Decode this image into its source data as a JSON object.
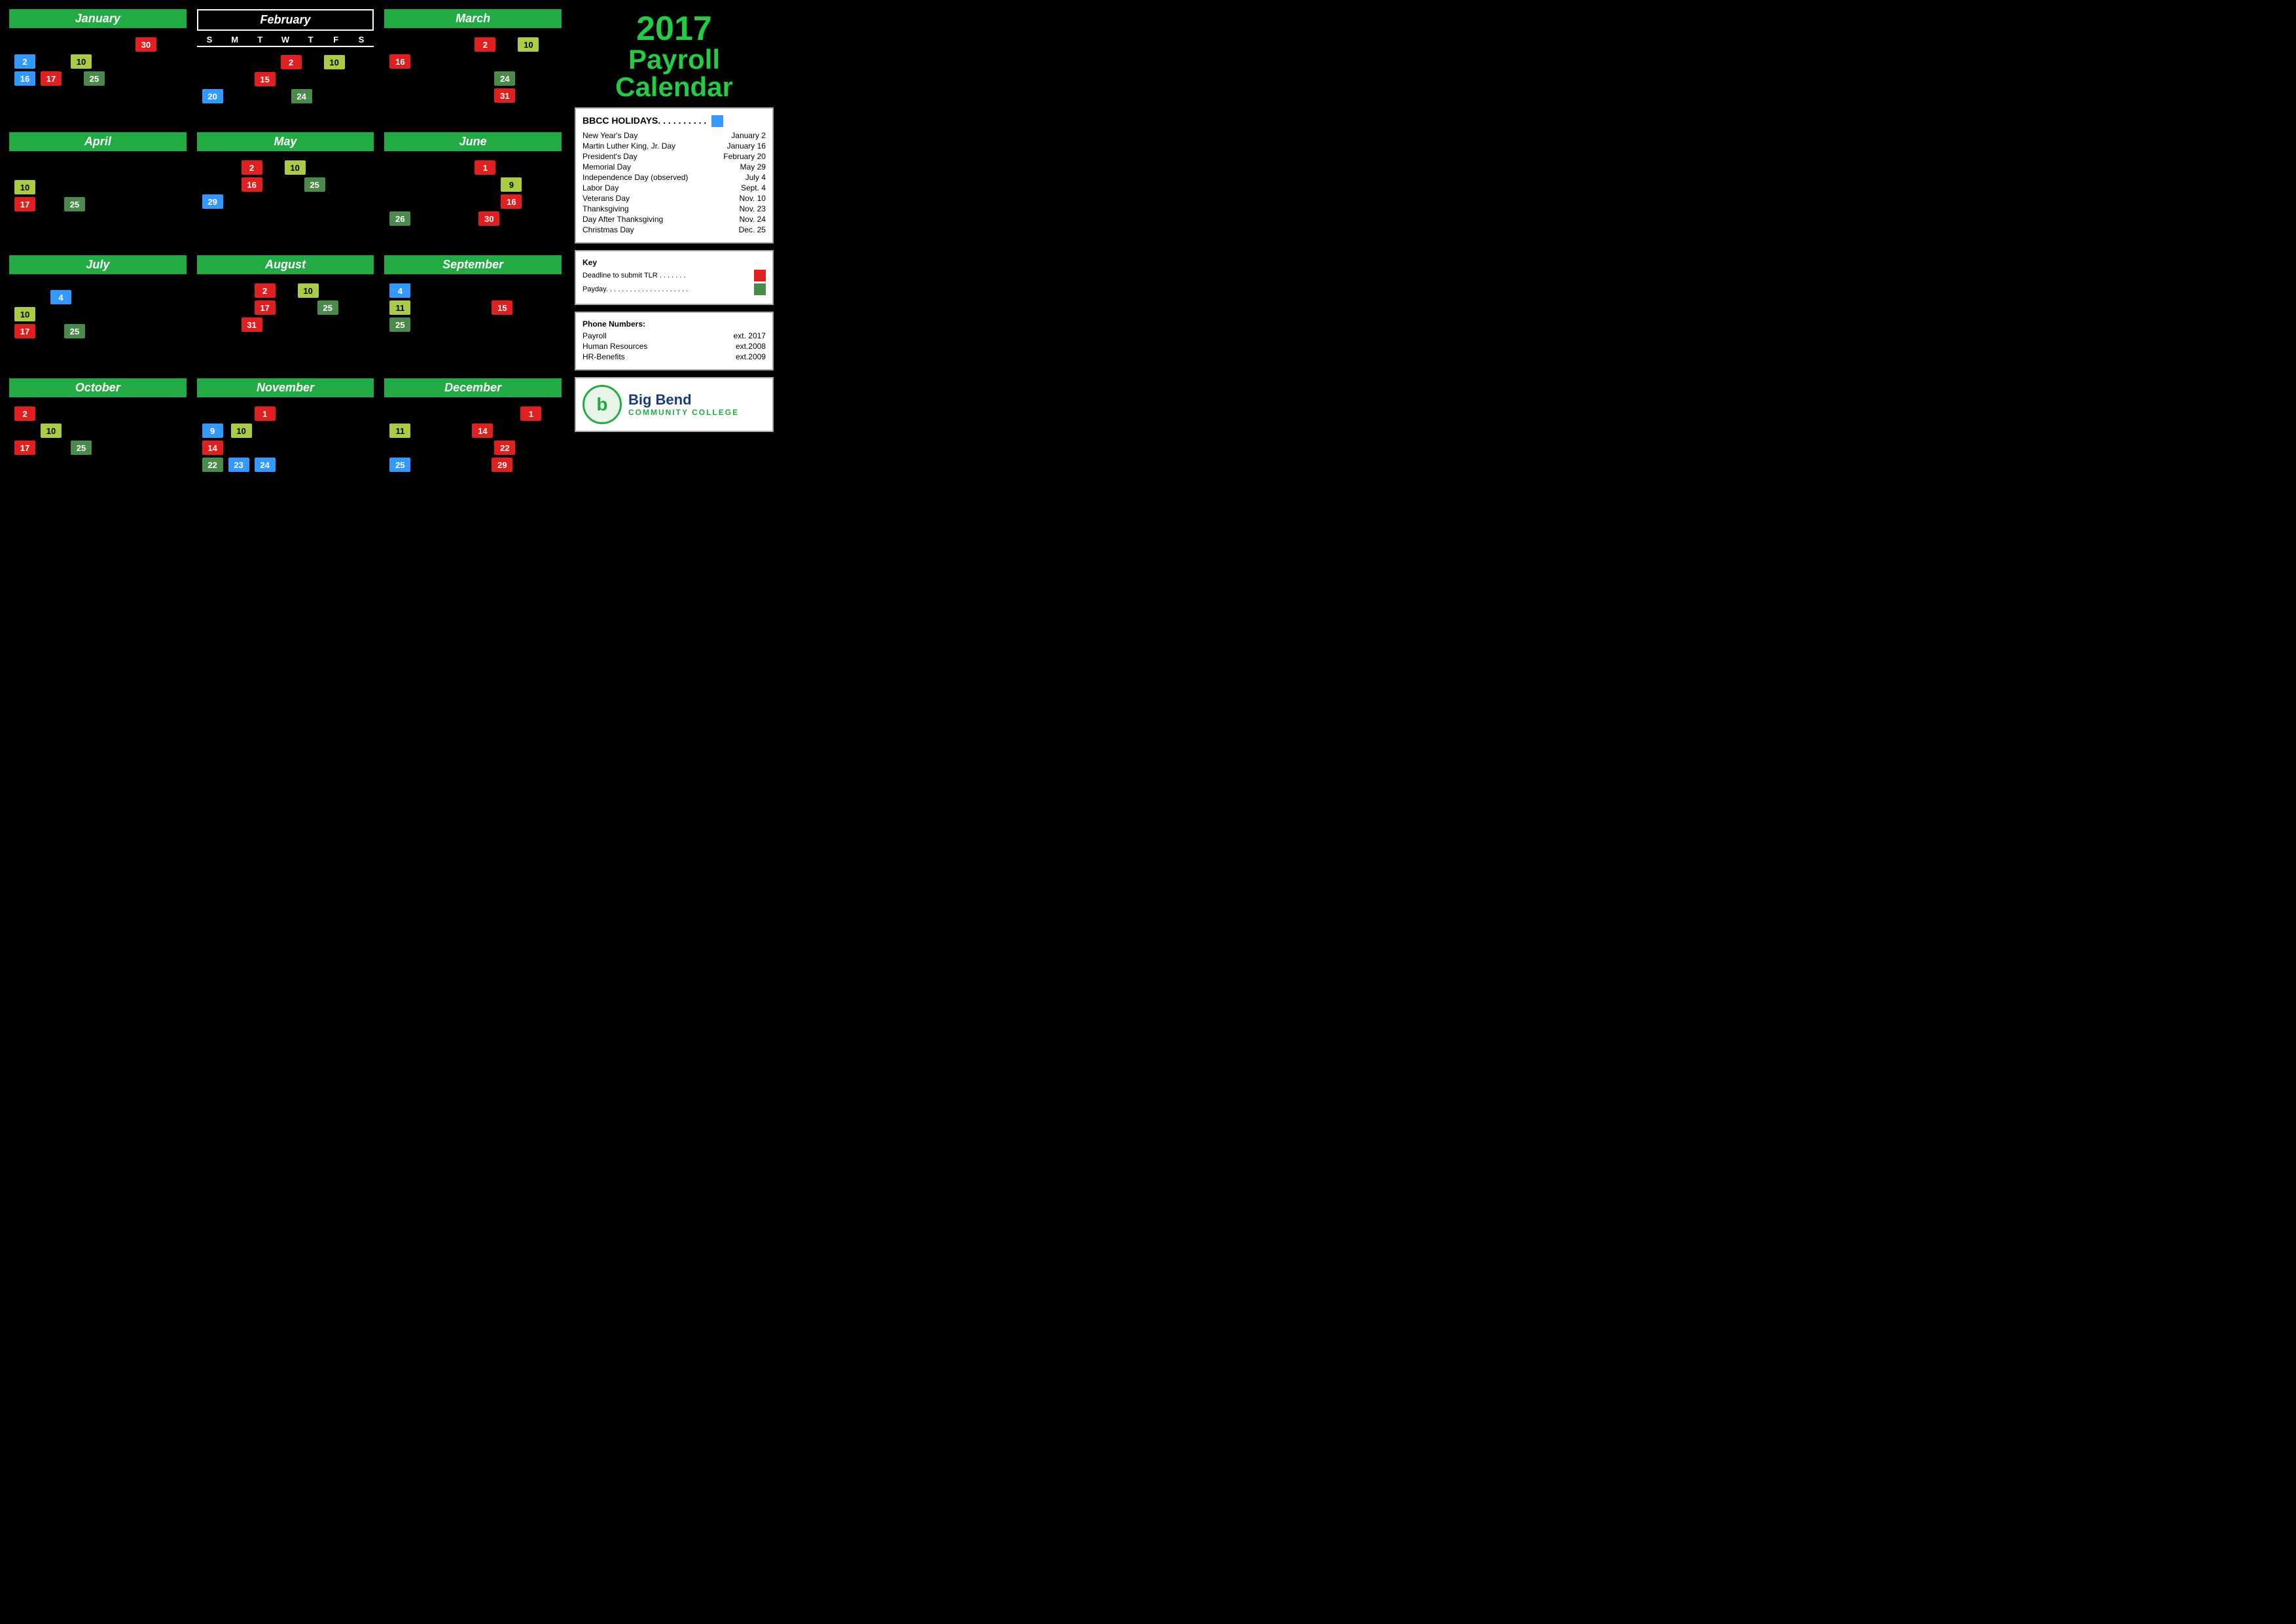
{
  "title": {
    "year": "2017",
    "line1": "Payroll",
    "line2": "Calendar"
  },
  "months": {
    "january": {
      "name": "January",
      "dates": [
        {
          "num": "30",
          "color": "red",
          "indent": 180
        },
        {
          "num": "2",
          "color": "blue",
          "indent": 0
        },
        {
          "num": "10",
          "color": "yellow-green",
          "indent": 60
        },
        {
          "num": "16",
          "color": "blue",
          "indent": 0
        },
        {
          "num": "17",
          "color": "red",
          "indent": 36
        },
        {
          "num": "25",
          "color": "green",
          "indent": 80
        }
      ]
    },
    "february": {
      "name": "February",
      "dayLabels": [
        "S",
        "M",
        "T",
        "W",
        "T",
        "F",
        "S"
      ],
      "dates": [
        {
          "num": "2",
          "color": "red",
          "indent": 120
        },
        {
          "num": "10",
          "color": "yellow-green",
          "indent": 150
        },
        {
          "num": "15",
          "color": "red",
          "indent": 80
        },
        {
          "num": "20",
          "color": "blue",
          "indent": 0
        },
        {
          "num": "24",
          "color": "green",
          "indent": 140
        }
      ]
    },
    "march": {
      "name": "March",
      "dates": [
        {
          "num": "2",
          "color": "red",
          "indent": 130
        },
        {
          "num": "10",
          "color": "yellow-green",
          "indent": 160
        },
        {
          "num": "16",
          "color": "red",
          "indent": 0
        },
        {
          "num": "24",
          "color": "green",
          "indent": 160
        },
        {
          "num": "31",
          "color": "red",
          "indent": 160
        }
      ]
    },
    "april": {
      "name": "April",
      "dates": [
        {
          "num": "10",
          "color": "yellow-green",
          "indent": 0
        },
        {
          "num": "17",
          "color": "red",
          "indent": 0
        },
        {
          "num": "25",
          "color": "green",
          "indent": 60
        }
      ]
    },
    "may": {
      "name": "May",
      "dates": [
        {
          "num": "2",
          "color": "red",
          "indent": 60
        },
        {
          "num": "10",
          "color": "yellow-green",
          "indent": 90
        },
        {
          "num": "16",
          "color": "red",
          "indent": 60
        },
        {
          "num": "25",
          "color": "green",
          "indent": 140
        },
        {
          "num": "29",
          "color": "blue",
          "indent": 0
        }
      ]
    },
    "june": {
      "name": "June",
      "dates": [
        {
          "num": "1",
          "color": "red",
          "indent": 130
        },
        {
          "num": "9",
          "color": "yellow-green",
          "indent": 180
        },
        {
          "num": "16",
          "color": "red",
          "indent": 180
        },
        {
          "num": "26",
          "color": "green",
          "indent": 0
        },
        {
          "num": "30",
          "color": "red",
          "indent": 130
        }
      ]
    },
    "july": {
      "name": "July",
      "dates": [
        {
          "num": "4",
          "color": "blue",
          "indent": 60
        },
        {
          "num": "10",
          "color": "yellow-green",
          "indent": 0
        },
        {
          "num": "17",
          "color": "red",
          "indent": 0
        },
        {
          "num": "25",
          "color": "green",
          "indent": 60
        }
      ]
    },
    "august": {
      "name": "August",
      "dates": [
        {
          "num": "2",
          "color": "red",
          "indent": 80
        },
        {
          "num": "10",
          "color": "yellow-green",
          "indent": 110
        },
        {
          "num": "17",
          "color": "red",
          "indent": 80
        },
        {
          "num": "25",
          "color": "green",
          "indent": 140
        },
        {
          "num": "31",
          "color": "red",
          "indent": 60
        }
      ]
    },
    "september": {
      "name": "September",
      "dates": [
        {
          "num": "4",
          "color": "blue",
          "indent": 0
        },
        {
          "num": "11",
          "color": "yellow-green",
          "indent": 0
        },
        {
          "num": "15",
          "color": "red",
          "indent": 160
        },
        {
          "num": "25",
          "color": "green",
          "indent": 0
        }
      ]
    },
    "october": {
      "name": "October",
      "dates": [
        {
          "num": "2",
          "color": "red",
          "indent": 0
        },
        {
          "num": "10",
          "color": "yellow-green",
          "indent": 40
        },
        {
          "num": "17",
          "color": "red",
          "indent": 0
        },
        {
          "num": "25",
          "color": "green",
          "indent": 70
        }
      ]
    },
    "november": {
      "name": "November",
      "dates": [
        {
          "num": "1",
          "color": "red",
          "indent": 80
        },
        {
          "num": "9",
          "color": "blue",
          "indent": 0
        },
        {
          "num": "10",
          "color": "yellow-green",
          "indent": 40
        },
        {
          "num": "14",
          "color": "red",
          "indent": 0
        },
        {
          "num": "22",
          "color": "green",
          "indent": 0
        },
        {
          "num": "23",
          "color": "blue",
          "indent": 40
        },
        {
          "num": "24",
          "color": "blue",
          "indent": 40
        }
      ]
    },
    "december": {
      "name": "December",
      "dates": [
        {
          "num": "1",
          "color": "red",
          "indent": 220
        },
        {
          "num": "11",
          "color": "yellow-green",
          "indent": 0
        },
        {
          "num": "14",
          "color": "red",
          "indent": 130
        },
        {
          "num": "22",
          "color": "red",
          "indent": 180
        },
        {
          "num": "25",
          "color": "blue",
          "indent": 0
        },
        {
          "num": "29",
          "color": "red",
          "indent": 180
        }
      ]
    }
  },
  "holidays": {
    "title": "BBCC HOLIDAYS. . . . . . . . . .",
    "indicator_color": "#3399ff",
    "items": [
      {
        "name": "New Year's Day",
        "date": "January 2"
      },
      {
        "name": "Martin Luther King, Jr. Day",
        "date": "January 16"
      },
      {
        "name": "President's Day",
        "date": "February 20"
      },
      {
        "name": "Memorial Day",
        "date": "May 29"
      },
      {
        "name": "Independence Day (observed)",
        "date": "July 4"
      },
      {
        "name": "Labor Day",
        "date": "Sept. 4"
      },
      {
        "name": "Veterans Day",
        "date": "Nov. 10"
      },
      {
        "name": "Thanksgiving",
        "date": "Nov. 23"
      },
      {
        "name": "Day After Thanksgiving",
        "date": "Nov. 24"
      },
      {
        "name": "Christmas Day",
        "date": "Dec. 25"
      }
    ]
  },
  "key": {
    "title": "Key",
    "tlr_label": "Deadline to submit TLR . . . . . . .",
    "tlr_color": "#e02020",
    "payday_label": "Payday. . . . . . . . . . . . . . . . . . . . .",
    "payday_color": "#4a8a4a"
  },
  "phone": {
    "title": "Phone Numbers:",
    "items": [
      {
        "label": "Payroll",
        "value": "ext. 2017"
      },
      {
        "label": "Human Resources",
        "value": "ext.2008"
      },
      {
        "label": "HR-Benefits",
        "value": "ext.2009"
      }
    ]
  },
  "logo": {
    "letter": "b",
    "name_line1": "Big Bend",
    "name_line2": "COMMUNITY COLLEGE"
  }
}
